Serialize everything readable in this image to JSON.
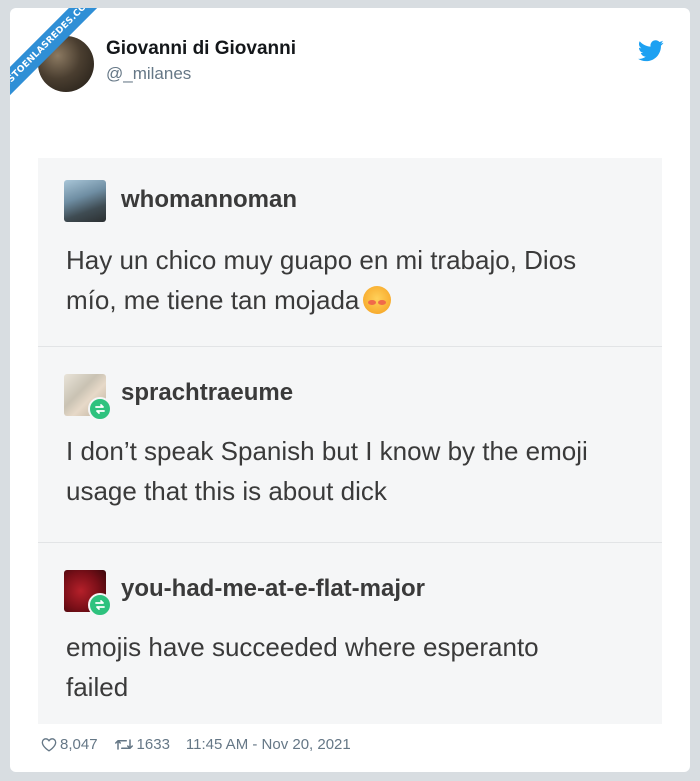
{
  "watermark": "VISTOENLASREDES.COM",
  "tweet": {
    "display_name": "Giovanni di Giovanni",
    "handle": "@_milanes",
    "likes": "8,047",
    "retweets": "1633",
    "timestamp": "11:45 AM - Nov 20, 2021"
  },
  "posts": [
    {
      "username": "whomannoman",
      "lines": [
        "Hay un chico muy guapo en mi trabajo, Dios",
        "mío, me tiene tan mojada"
      ],
      "reblog": false
    },
    {
      "username": "sprachtraeume",
      "lines": [
        "I don’t speak Spanish but I know by the emoji",
        "usage that this is about dick"
      ],
      "reblog": true
    },
    {
      "username": "you-had-me-at-e-flat-major",
      "lines": [
        "emojis have succeeded where esperanto",
        "failed"
      ],
      "reblog": true
    }
  ],
  "colors": {
    "twitter_blue": "#1da1f2",
    "reblog_green": "#2ec27e",
    "ribbon_blue": "#2f8fd6"
  },
  "icons": [
    "twitter-bird-icon",
    "reblog-icon",
    "heart-icon",
    "retweet-icon",
    "flushed-face-emoji"
  ]
}
